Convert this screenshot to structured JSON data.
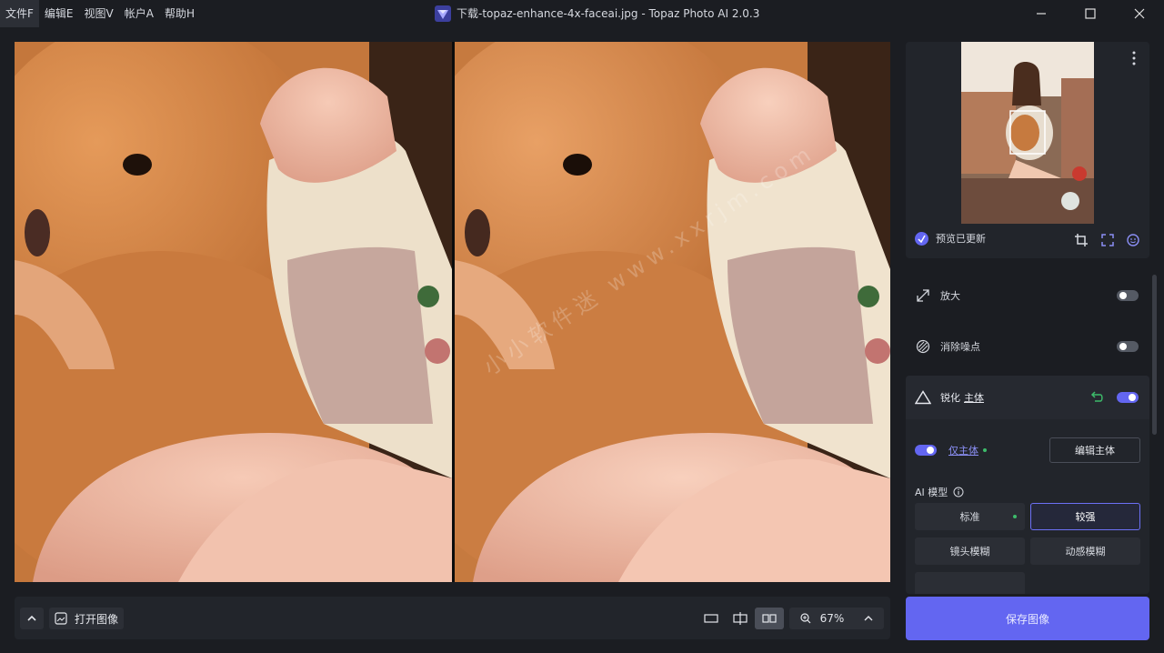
{
  "menu": [
    {
      "label": "文件F"
    },
    {
      "label": "编辑E"
    },
    {
      "label": "视图V"
    },
    {
      "label": "帐户A"
    },
    {
      "label": "帮助H"
    }
  ],
  "window": {
    "title": "下载-topaz-enhance-4x-faceai.jpg - Topaz Photo AI 2.0.3"
  },
  "viewer": {
    "watermark": "小小软件迷 www.xxrjm.com"
  },
  "preview": {
    "status": "预览已更新"
  },
  "features": {
    "upscale": {
      "label": "放大",
      "enabled": false
    },
    "denoise": {
      "label": "消除噪点",
      "enabled": false
    },
    "sharpen": {
      "label": "锐化",
      "subject_label": "主体",
      "enabled": true,
      "subject_only": {
        "label": "仅主体",
        "enabled": true
      },
      "edit_subject": "编辑主体",
      "model_heading": "AI 模型",
      "models": [
        {
          "label": "标准",
          "selected": false,
          "recommended": true
        },
        {
          "label": "较强",
          "selected": true,
          "recommended": false
        },
        {
          "label": "镜头模糊",
          "selected": false,
          "recommended": false
        },
        {
          "label": "动感模糊",
          "selected": false,
          "recommended": false
        }
      ]
    }
  },
  "bottombar": {
    "open_image": "打开图像",
    "zoom": "67%"
  },
  "save": {
    "label": "保存图像"
  },
  "colors": {
    "accent": "#6366f1",
    "green": "#3dbb6a"
  }
}
